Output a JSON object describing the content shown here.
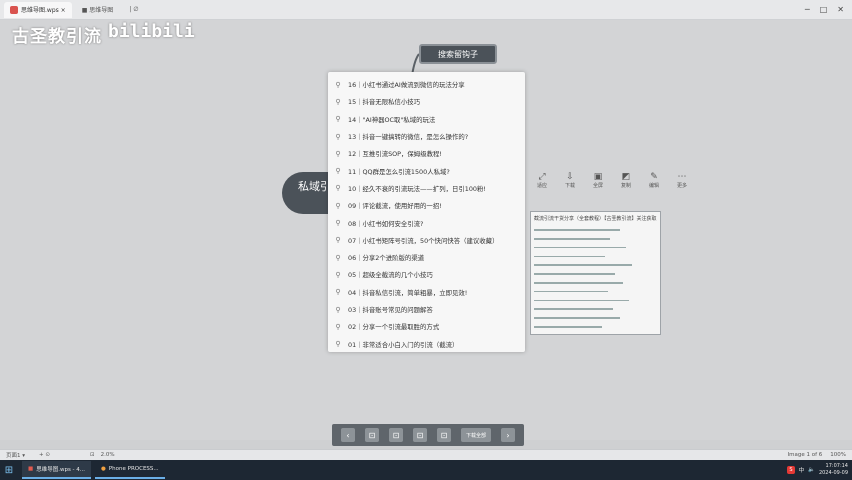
{
  "window": {
    "tab_title": "思维导图.wps ×",
    "tab2": "■ 思维导图",
    "tab3": "| ∅",
    "controls": [
      "─",
      "□",
      "✕"
    ]
  },
  "watermark": {
    "text": "古圣教引流",
    "logo": "bilibili"
  },
  "mindmap": {
    "root_label": "私域引流 古圣",
    "branch_label": "搜索留钩子"
  },
  "panel": {
    "items": [
      "16｜小红书通过AI做流到微信的玩法分享",
      "15｜抖音无限私信小技巧",
      "14｜\"AI神器OC取\"私域的玩法",
      "13｜抖音一键搞转的微信，是怎么操作的?",
      "12｜互推引流SOP，保姆级教程!",
      "11｜QQ群是怎么引流1500人私域?",
      "10｜经久不衰的引流玩法——扩列，日引100粉!",
      "09｜评论截流，使用好用的一招!",
      "08｜小红书如何安全引流?",
      "07｜小红书矩阵号引流，50个快问快答（建议收藏）",
      "06｜分享2个进阶版的渠道",
      "05｜超级全截流的几个小技巧",
      "04｜抖音私信引流，简单粗暴，立即见效!",
      "03｜抖音账号常见的问题解答",
      "02｜分享一个引流最取胜的方式",
      "01｜非常适合小白入门的引流（截流）"
    ]
  },
  "toolstrip": {
    "tools": [
      {
        "icon": "⤢",
        "label": "适应"
      },
      {
        "icon": "⇩",
        "label": "下载"
      },
      {
        "icon": "▣",
        "label": "全屏"
      },
      {
        "icon": "◩",
        "label": "复制"
      },
      {
        "icon": "✎",
        "label": "编辑"
      },
      {
        "icon": "⋯",
        "label": "更多"
      }
    ]
  },
  "mini": {
    "title": "截流引流干货分享（全套教程）【古圣教引流】关注获取"
  },
  "player": {
    "buttons": [
      "‹",
      "⊡",
      "⊡",
      "⊡",
      "⊡"
    ],
    "download_label": "下载全部",
    "next": "›"
  },
  "statusbar": {
    "left": "页面1 ▾",
    "left2": "+  ⊙",
    "mid": "⊡",
    "zoom_text": "2.0%",
    "right_label": "Image 1 of 6",
    "zoom_level": "100%"
  },
  "taskbar": {
    "task1": "思维导图.wps - 4...",
    "task2": "Phone PROCESS...",
    "tray_badge": "S",
    "ime": "中",
    "time": "17:07:14",
    "date": "2024-09-09"
  }
}
